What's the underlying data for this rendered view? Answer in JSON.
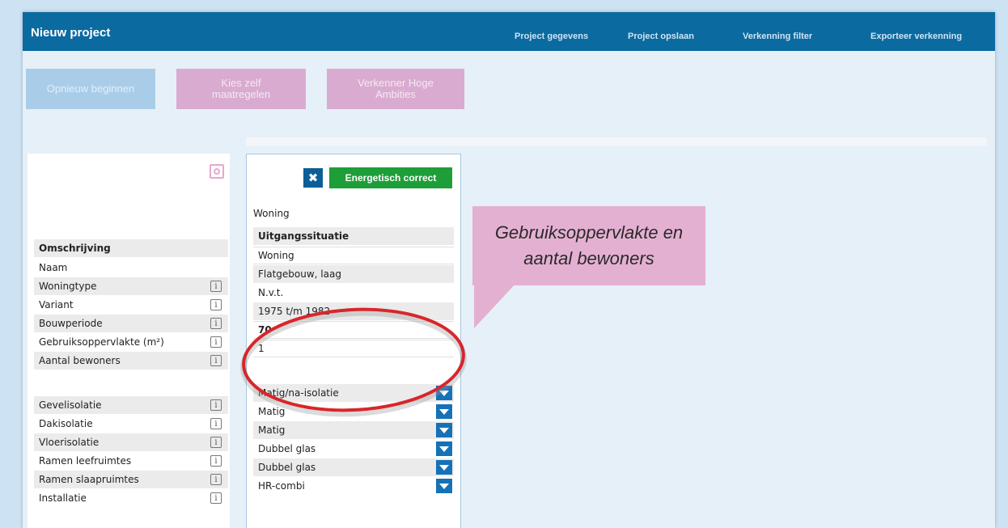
{
  "window": {
    "title": "Nieuw project"
  },
  "nav": {
    "items": [
      "Project gegevens",
      "Project opslaan",
      "Verkenning filter",
      "Exporteer verkenning"
    ]
  },
  "actions": {
    "restart": "Opnieuw beginnen",
    "choose": "Kies zelf\nmaatregelen",
    "explore": "Verkenner Hoge\nAmbities"
  },
  "labels": {
    "header": "Omschrijving",
    "rows": [
      "Naam",
      "Woningtype",
      "Variant",
      "Bouwperiode",
      "Gebruiksoppervlakte (m²)",
      "Aantal bewoners"
    ],
    "rows2": [
      "Gevelisolatie",
      "Dakisolatie",
      "Vloerisolatie",
      "Ramen leefruimtes",
      "Ramen slaapruimtes",
      "Installatie"
    ],
    "info_icon": "i"
  },
  "column": {
    "close_icon": "✖",
    "status": "Energetisch correct",
    "title": "Woning",
    "header": "Uitgangssituatie",
    "values": [
      "Woning",
      "Flatgebouw, laag",
      "N.v.t.",
      "1975 t/m 1982",
      "70",
      "1"
    ],
    "measures": [
      "Matig/na-isolatie",
      "Matig",
      "Matig",
      "Dubbel glas",
      "Dubbel glas",
      "HR-combi"
    ]
  },
  "callout": {
    "text": "Gebruiksoppervlakte en\naantal bewoners"
  },
  "colors": {
    "topbar": "#0b6aa0",
    "status_green": "#1e9e38",
    "callout_pink": "#e4b0d2",
    "annotation_red": "#d8262b"
  }
}
